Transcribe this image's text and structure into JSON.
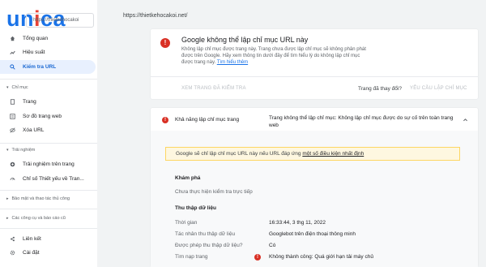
{
  "brand": {
    "logo_u": "un",
    "logo_i": "i",
    "logo_rest": "ca",
    "property": "https://thietkehocakoi"
  },
  "topbar": {
    "url": "https://thietkehocakoi.net/"
  },
  "sidebar": {
    "items": [
      {
        "label": "Tổng quan",
        "icon": "home-icon"
      },
      {
        "label": "Hiệu suất",
        "icon": "trend-icon"
      },
      {
        "label": "Kiểm tra URL",
        "icon": "search-icon"
      }
    ],
    "sections": [
      {
        "label": "Chỉ mục",
        "items": [
          {
            "label": "Trang",
            "icon": "page-icon"
          },
          {
            "label": "Sơ đồ trang web",
            "icon": "sitemap-icon"
          },
          {
            "label": "Xóa URL",
            "icon": "eye-off-icon"
          }
        ]
      },
      {
        "label": "Trải nghiệm",
        "items": [
          {
            "label": "Trải nghiệm trên trang",
            "icon": "plus-circle-icon"
          },
          {
            "label": "Chỉ số Thiết yếu về Tran...",
            "icon": "gauge-icon"
          }
        ]
      },
      {
        "label": "Bảo mật và thao tác thủ công"
      },
      {
        "label": "Các công cụ và báo cáo cũ"
      }
    ],
    "bottom": [
      {
        "label": "Liên kết",
        "icon": "links-icon"
      },
      {
        "label": "Cài đặt",
        "icon": "gear-icon"
      }
    ]
  },
  "card1": {
    "title": "Google không thể lập chỉ mục URL này",
    "desc": "Không lập chỉ mục được trang này. Trang chưa được lập chỉ mục sẽ không phân phát được trên Google. Hãy xem thông tin dưới đây để tìm hiểu lý do không lập chỉ mục được trang này.",
    "learn_more": "Tìm hiểu thêm",
    "view_tested": "XEM TRANG ĐÃ KIỂM TRA",
    "changed_q": "Trang đã thay đổi?",
    "request_index": "YÊU CẦU LẬP CHỈ MỤC"
  },
  "card2": {
    "row_label": "Khả năng lập chỉ mục trang",
    "row_value": "Trang không thể lập chỉ mục: Không lập chỉ mục được do sự cố trên toàn trang web",
    "warning_text": "Google sẽ chỉ lập chỉ mục URL này nếu URL đáp ứng ",
    "warning_link": "một số điều kiện nhất định",
    "discovery_title": "Khám phá",
    "discovery_text": "Chưa thực hiện kiểm tra trực tiếp",
    "crawl_title": "Thu thập dữ liệu",
    "crawl": [
      {
        "key": "Thời gian",
        "value": "16:33:44, 3 thg 11, 2022"
      },
      {
        "key": "Tác nhân thu thập dữ liệu",
        "value": "Googlebot trên điện thoại thông minh"
      },
      {
        "key": "Được phép thu thập dữ liệu?",
        "value": "Có"
      },
      {
        "key": "Tìm nạp trang",
        "value": "Không thành công: Quá giới hạn tải máy chủ"
      }
    ]
  },
  "colors": {
    "accent": "#1a73e8",
    "error": "#d93025",
    "warning_bg": "#fef7e0"
  }
}
